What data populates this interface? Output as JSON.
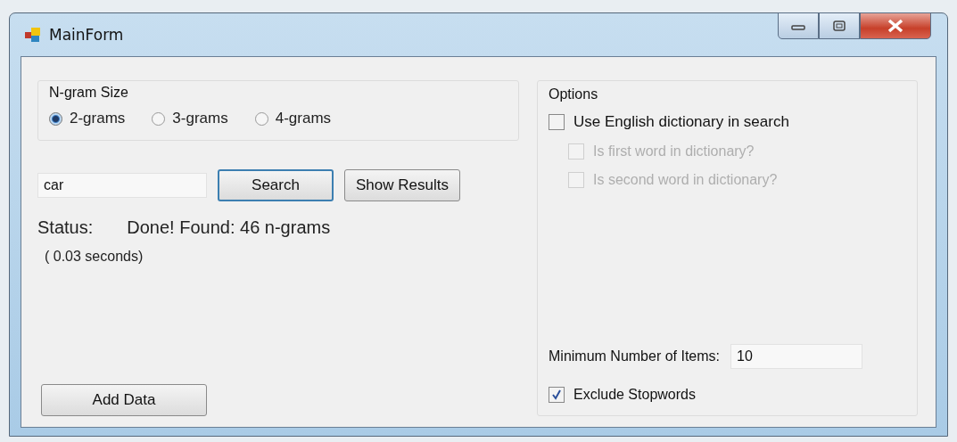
{
  "window": {
    "title": "MainForm"
  },
  "ngram_size": {
    "label": "N-gram Size",
    "options": [
      {
        "label": "2-grams",
        "selected": true
      },
      {
        "label": "3-grams",
        "selected": false
      },
      {
        "label": "4-grams",
        "selected": false
      }
    ]
  },
  "search": {
    "value": "car",
    "buttons": [
      {
        "label": "Search",
        "focused": true
      },
      {
        "label": "Show Results",
        "focused": false
      }
    ]
  },
  "status": {
    "label": "Status:",
    "value": "Done! Found: 46 n-grams",
    "time": "( 0.03 seconds)"
  },
  "add_data_button": "Add Data",
  "options": {
    "title": "Options",
    "checkboxes": [
      {
        "label": "Use English dictionary in search",
        "checked": false,
        "disabled": false,
        "children": [
          {
            "label": "Is first word in dictionary?",
            "checked": false,
            "disabled": true
          },
          {
            "label": "Is second word in dictionary?",
            "checked": false,
            "disabled": true
          }
        ]
      }
    ],
    "min_items": {
      "label": "Minimum Number of Items:",
      "value": "10"
    },
    "exclude_stopwords": {
      "label": "Exclude Stopwords",
      "checked": true,
      "disabled": false
    }
  }
}
